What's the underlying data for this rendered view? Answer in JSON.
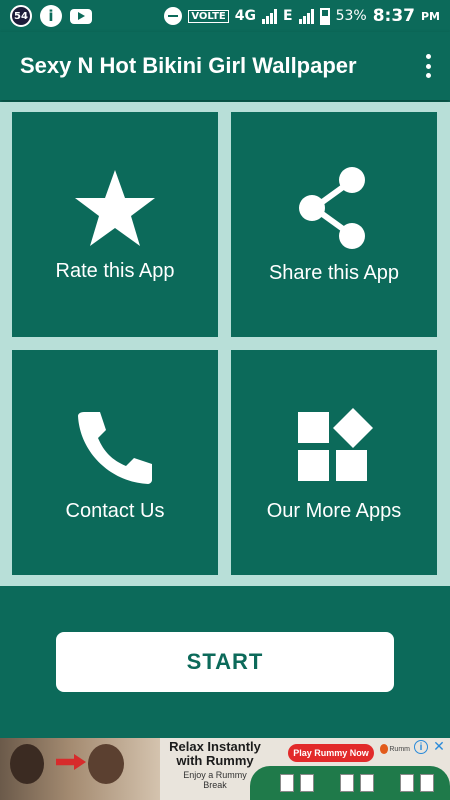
{
  "status_bar": {
    "notification_count": "54",
    "info_icon": "info-icon",
    "youtube_icon": "youtube-icon",
    "volte": "VOLTE",
    "network": "4G",
    "network2": "E",
    "battery": "53%",
    "time": "8:37",
    "ampm": "PM"
  },
  "appbar": {
    "title": "Sexy N Hot Bikini Girl Wallpaper",
    "menu_icon": "more-vert-icon"
  },
  "tiles": [
    {
      "label": "Rate this App",
      "icon": "star-icon"
    },
    {
      "label": "Share this App",
      "icon": "share-icon"
    },
    {
      "label": "Contact Us",
      "icon": "phone-icon"
    },
    {
      "label": "Our More Apps",
      "icon": "apps-icon"
    }
  ],
  "start_button": {
    "label": "START"
  },
  "ad": {
    "headline": "Relax Instantly with Rummy",
    "sub": "Enjoy a Rummy Break",
    "cta": "Play Rummy Now",
    "brand": "Rumm"
  },
  "colors": {
    "primary": "#0c6a5a",
    "grid_background": "#b8dfd8",
    "text_on_primary": "#ffffff"
  }
}
